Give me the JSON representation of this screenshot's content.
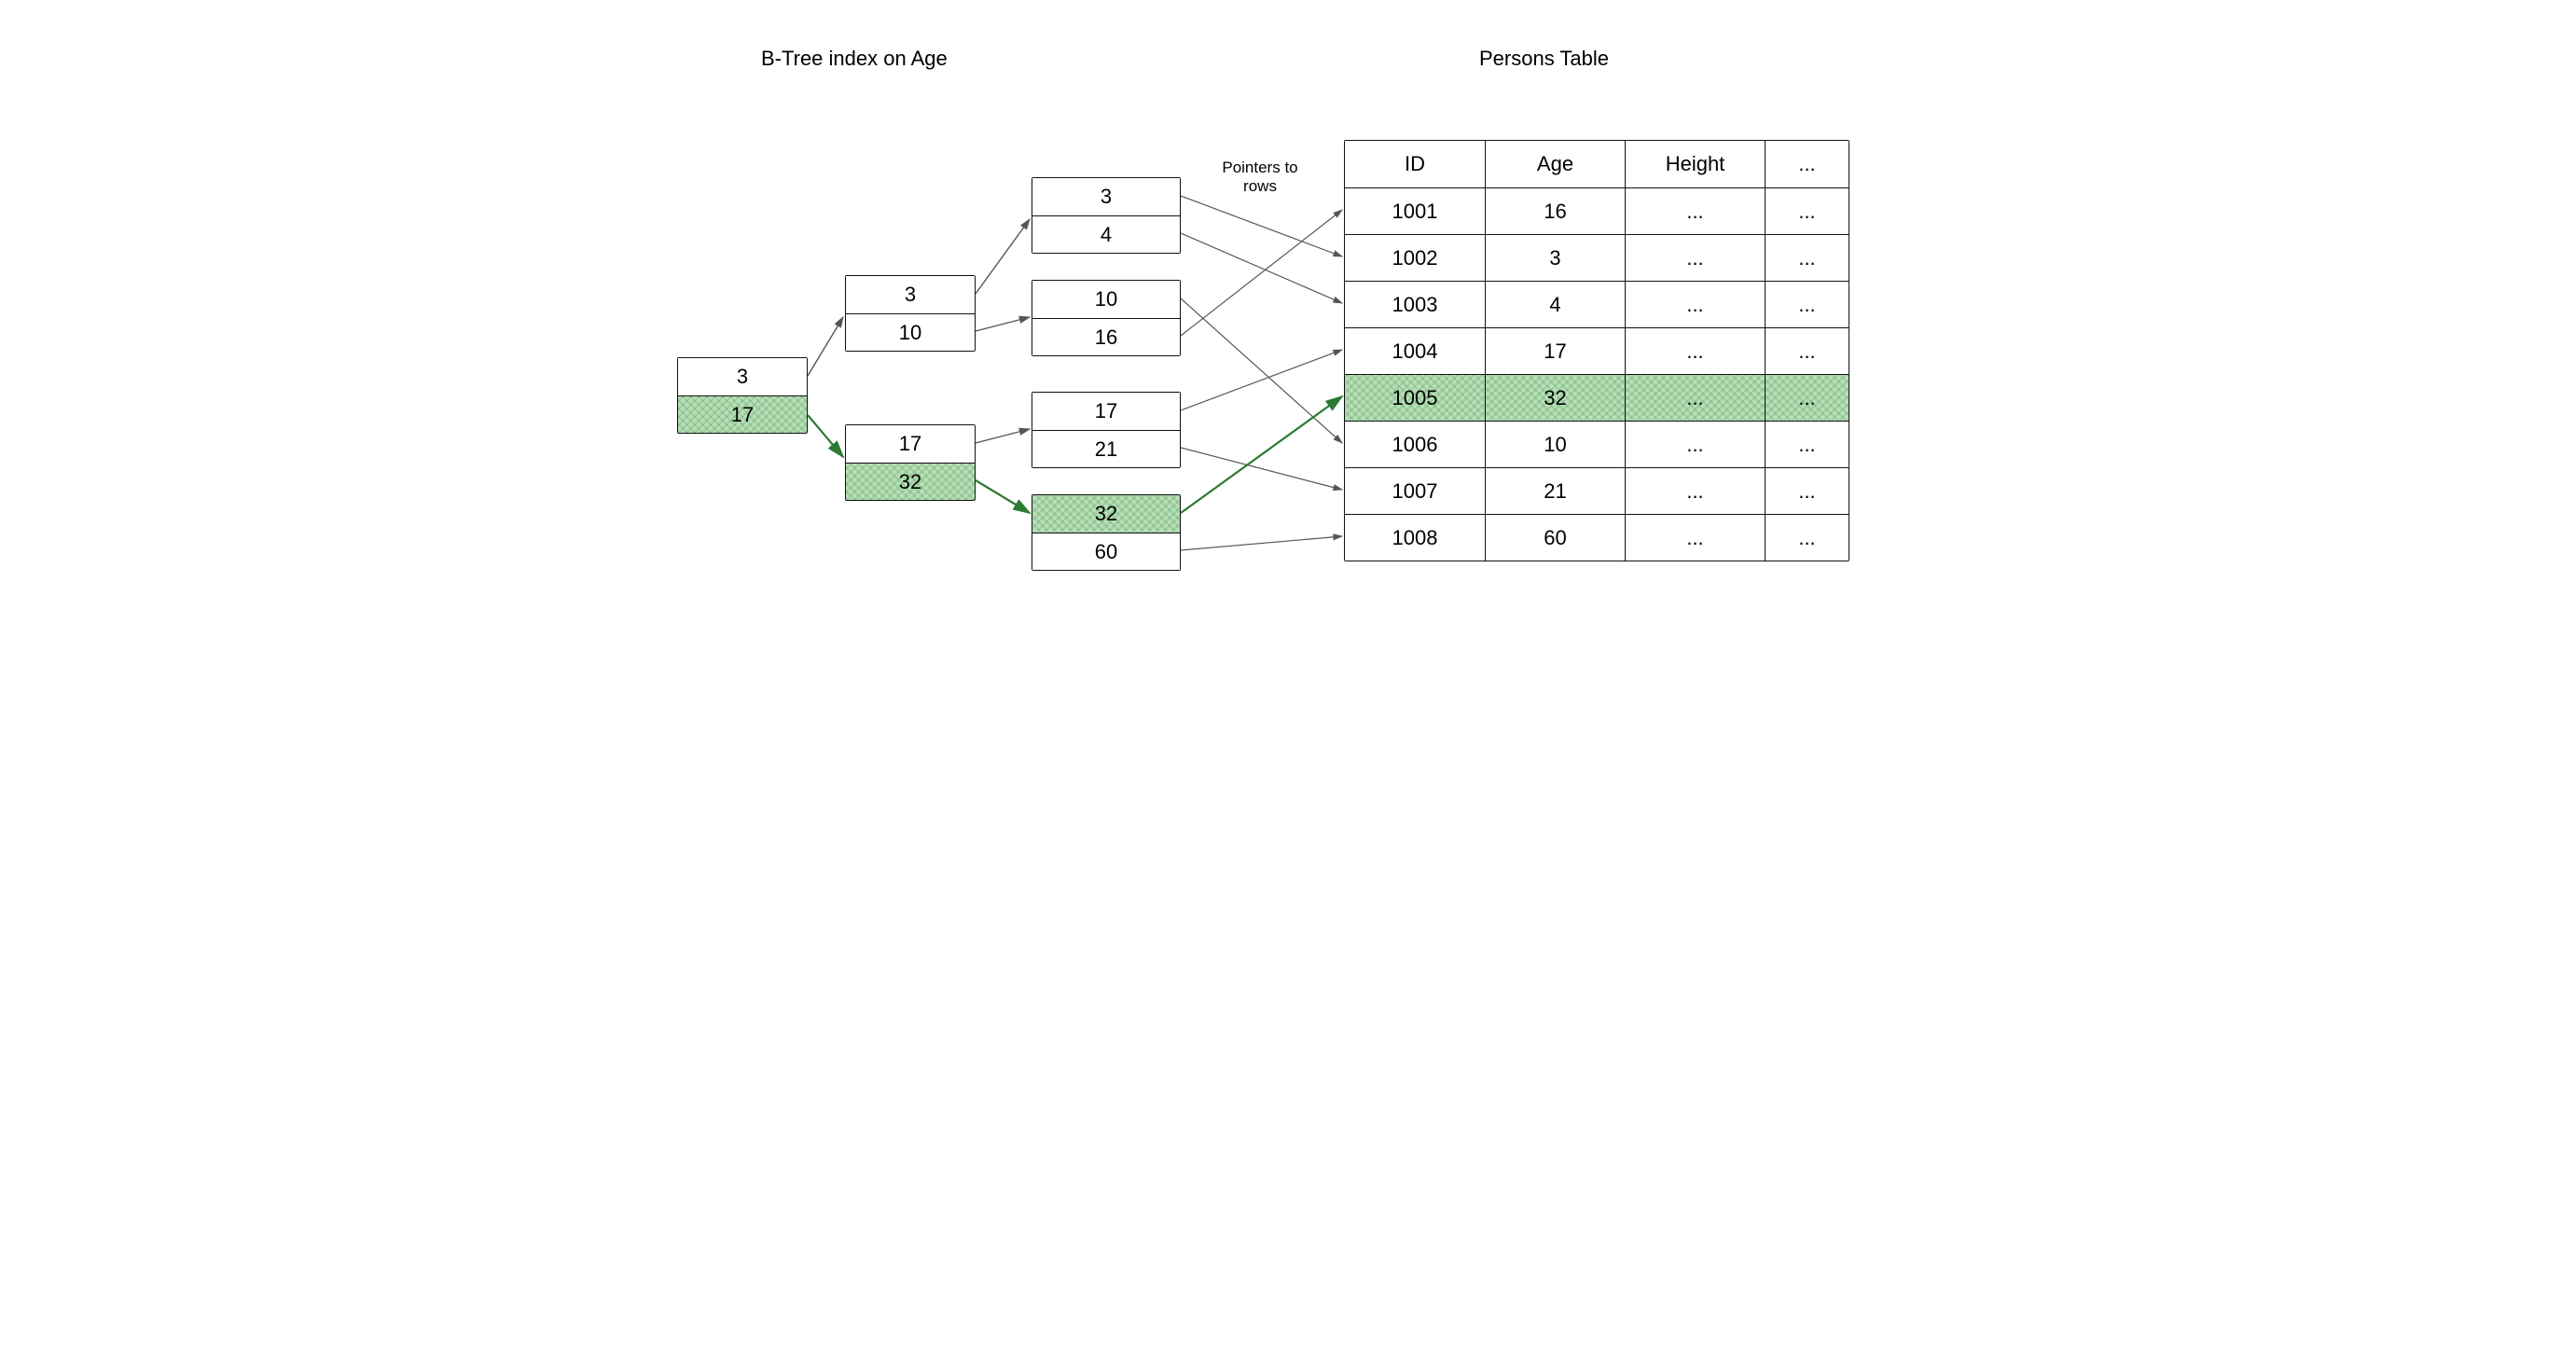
{
  "titles": {
    "left": "B-Tree index on Age",
    "right": "Persons Table"
  },
  "labels": {
    "pointers": "Pointers to\nrows"
  },
  "btree": {
    "root": {
      "keys": [
        "3",
        "17"
      ],
      "highlight": [
        1
      ]
    },
    "level1": [
      {
        "keys": [
          "3",
          "10"
        ],
        "highlight": []
      },
      {
        "keys": [
          "17",
          "32"
        ],
        "highlight": [
          1
        ]
      }
    ],
    "leaves": [
      {
        "keys": [
          "3",
          "4"
        ],
        "highlight": []
      },
      {
        "keys": [
          "10",
          "16"
        ],
        "highlight": []
      },
      {
        "keys": [
          "17",
          "21"
        ],
        "highlight": []
      },
      {
        "keys": [
          "32",
          "60"
        ],
        "highlight": [
          0
        ]
      }
    ]
  },
  "table": {
    "headers": [
      "ID",
      "Age",
      "Height",
      "..."
    ],
    "rows": [
      {
        "cells": [
          "1001",
          "16",
          "...",
          "..."
        ],
        "hl": false
      },
      {
        "cells": [
          "1002",
          "3",
          "...",
          "..."
        ],
        "hl": false
      },
      {
        "cells": [
          "1003",
          "4",
          "...",
          "..."
        ],
        "hl": false
      },
      {
        "cells": [
          "1004",
          "17",
          "...",
          "..."
        ],
        "hl": false
      },
      {
        "cells": [
          "1005",
          "32",
          "...",
          "..."
        ],
        "hl": true
      },
      {
        "cells": [
          "1006",
          "10",
          "...",
          "..."
        ],
        "hl": false
      },
      {
        "cells": [
          "1007",
          "21",
          "...",
          "..."
        ],
        "hl": false
      },
      {
        "cells": [
          "1008",
          "60",
          "...",
          "..."
        ],
        "hl": false
      }
    ]
  },
  "colors": {
    "highlight": "#b8e0b8",
    "highlight_stroke": "#2d7a33",
    "line": "#555"
  }
}
